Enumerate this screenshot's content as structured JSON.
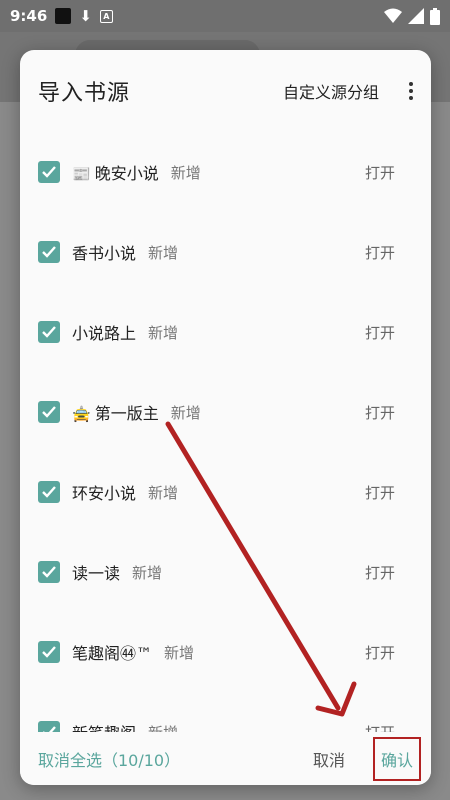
{
  "status_bar": {
    "time": "9:46",
    "icons": [
      "black-square-icon",
      "download-icon",
      "a-box-icon",
      "wifi-icon",
      "signal-icon",
      "battery-icon"
    ]
  },
  "dialog": {
    "title": "导入书源",
    "custom_group_label": "自定义源分组",
    "more_icon": "more-vertical-icon",
    "items": [
      {
        "emoji": "📰",
        "name": "晚安小说",
        "tag": "新增",
        "action": "打开",
        "checked": true
      },
      {
        "emoji": "",
        "name": "香书小说",
        "tag": "新增",
        "action": "打开",
        "checked": true
      },
      {
        "emoji": "",
        "name": "小说路上",
        "tag": "新增",
        "action": "打开",
        "checked": true
      },
      {
        "emoji": "🚖",
        "name": "第一版主",
        "tag": "新增",
        "action": "打开",
        "checked": true
      },
      {
        "emoji": "",
        "name": "环安小说",
        "tag": "新增",
        "action": "打开",
        "checked": true
      },
      {
        "emoji": "",
        "name": "读一读",
        "tag": "新增",
        "action": "打开",
        "checked": true
      },
      {
        "emoji": "",
        "name": "笔趣阁㊹™",
        "tag": "新增",
        "action": "打开",
        "checked": true
      },
      {
        "emoji": "",
        "name": "新笔趣阁",
        "tag": "新增",
        "action": "打开",
        "checked": true
      }
    ],
    "footer": {
      "select_label": "取消全选（10/10）",
      "cancel_label": "取消",
      "confirm_label": "确认"
    }
  },
  "colors": {
    "accent": "#5aa69d",
    "annotation_red": "#b22222",
    "scrim": "#8a8a8a"
  }
}
